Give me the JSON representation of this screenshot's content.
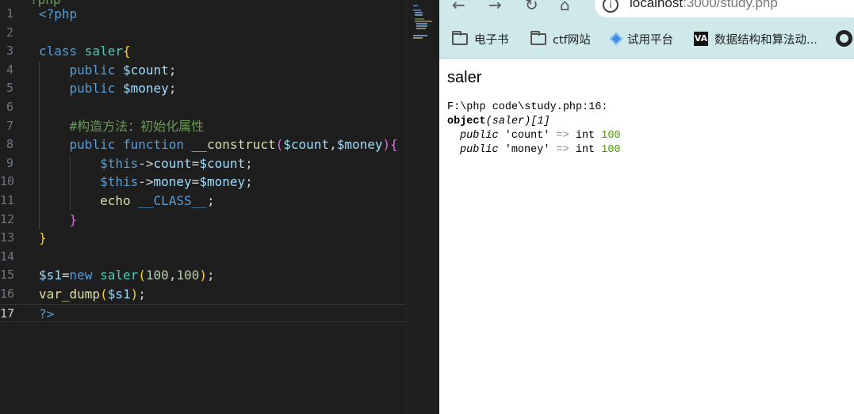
{
  "editor": {
    "top_clip": "?php",
    "lines": [
      {
        "n": "1",
        "tokens": [
          {
            "t": "<?php",
            "c": "tag"
          }
        ]
      },
      {
        "n": "2",
        "tokens": []
      },
      {
        "n": "3",
        "tokens": [
          {
            "t": "class ",
            "c": "kw"
          },
          {
            "t": "saler",
            "c": "cls"
          },
          {
            "t": "{",
            "c": "b1"
          }
        ]
      },
      {
        "n": "4",
        "tokens": [
          {
            "t": "    public ",
            "c": "kw"
          },
          {
            "t": "$count",
            "c": "var"
          },
          {
            "t": ";",
            "c": "pl"
          }
        ]
      },
      {
        "n": "5",
        "tokens": [
          {
            "t": "    public ",
            "c": "kw"
          },
          {
            "t": "$money",
            "c": "var"
          },
          {
            "t": ";",
            "c": "pl"
          }
        ]
      },
      {
        "n": "6",
        "tokens": []
      },
      {
        "n": "7",
        "tokens": [
          {
            "t": "    #构造方法：初始化属性",
            "c": "cm"
          }
        ]
      },
      {
        "n": "8",
        "tokens": [
          {
            "t": "    public ",
            "c": "kw"
          },
          {
            "t": "function ",
            "c": "kw"
          },
          {
            "t": "__construct",
            "c": "fn"
          },
          {
            "t": "(",
            "c": "b2"
          },
          {
            "t": "$count",
            "c": "var"
          },
          {
            "t": ",",
            "c": "pl"
          },
          {
            "t": "$money",
            "c": "var"
          },
          {
            "t": ")",
            "c": "b2"
          },
          {
            "t": "{",
            "c": "b2"
          }
        ]
      },
      {
        "n": "9",
        "tokens": [
          {
            "t": "        $this",
            "c": "kw"
          },
          {
            "t": "->",
            "c": "pl"
          },
          {
            "t": "count",
            "c": "var"
          },
          {
            "t": "=",
            "c": "pl"
          },
          {
            "t": "$count",
            "c": "var"
          },
          {
            "t": ";",
            "c": "pl"
          }
        ]
      },
      {
        "n": "10",
        "tokens": [
          {
            "t": "        $this",
            "c": "kw"
          },
          {
            "t": "->",
            "c": "pl"
          },
          {
            "t": "money",
            "c": "var"
          },
          {
            "t": "=",
            "c": "pl"
          },
          {
            "t": "$money",
            "c": "var"
          },
          {
            "t": ";",
            "c": "pl"
          }
        ]
      },
      {
        "n": "11",
        "tokens": [
          {
            "t": "        echo ",
            "c": "echo"
          },
          {
            "t": "__CLASS__",
            "c": "kw"
          },
          {
            "t": ";",
            "c": "pl"
          }
        ]
      },
      {
        "n": "12",
        "tokens": [
          {
            "t": "    }",
            "c": "b2"
          }
        ]
      },
      {
        "n": "13",
        "tokens": [
          {
            "t": "}",
            "c": "b1"
          }
        ]
      },
      {
        "n": "14",
        "tokens": []
      },
      {
        "n": "15",
        "tokens": [
          {
            "t": "$s1",
            "c": "var"
          },
          {
            "t": "=",
            "c": "pl"
          },
          {
            "t": "new ",
            "c": "kw"
          },
          {
            "t": "saler",
            "c": "cls"
          },
          {
            "t": "(",
            "c": "b1"
          },
          {
            "t": "100",
            "c": "num"
          },
          {
            "t": ",",
            "c": "pl"
          },
          {
            "t": "100",
            "c": "num"
          },
          {
            "t": ")",
            "c": "b1"
          },
          {
            "t": ";",
            "c": "pl"
          }
        ]
      },
      {
        "n": "16",
        "tokens": [
          {
            "t": "var_dump",
            "c": "fn"
          },
          {
            "t": "(",
            "c": "b1"
          },
          {
            "t": "$s1",
            "c": "var"
          },
          {
            "t": ")",
            "c": "b1"
          },
          {
            "t": ";",
            "c": "pl"
          }
        ]
      },
      {
        "n": "17",
        "tokens": [
          {
            "t": "?>",
            "c": "tag"
          }
        ],
        "active": true
      }
    ]
  },
  "browser": {
    "nav": {
      "back": "←",
      "forward": "→",
      "reload": "↻",
      "home": "⌂"
    },
    "url_host": "localhost",
    "url_rest": ":3000/study.php",
    "bookmarks": [
      {
        "label": "电子书",
        "icon": "folder-icon"
      },
      {
        "label": "ctf网站",
        "icon": "folder-icon"
      },
      {
        "label": "试用平台",
        "icon": "diamond-icon"
      },
      {
        "label": "数据结构和算法动...",
        "icon": "va-icon"
      }
    ],
    "github_icon": "github-icon",
    "output": {
      "title": "saler",
      "dump_header": "F:\\php code\\study.php:16:",
      "object_kw": "object",
      "object_class": "saler",
      "object_id": "[1]",
      "props": [
        {
          "vis": "public",
          "name": "'count'",
          "arrow": "=>",
          "type": "int",
          "value": "100"
        },
        {
          "vis": "public",
          "name": "'money'",
          "arrow": "=>",
          "type": "int",
          "value": "100"
        }
      ]
    }
  }
}
